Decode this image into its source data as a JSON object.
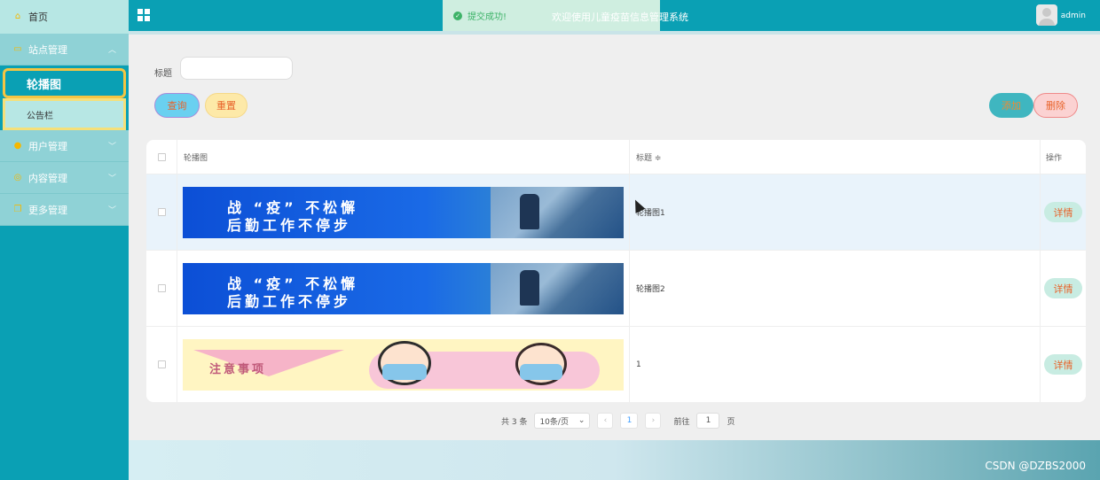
{
  "sidebar": {
    "home": {
      "label": "首页",
      "icon": "home-icon"
    },
    "groups": [
      {
        "label": "站点管理",
        "icon": "monitor-icon",
        "expanded": true
      },
      {
        "label": "用户管理",
        "icon": "user-icon",
        "expanded": false
      },
      {
        "label": "内容管理",
        "icon": "content-icon",
        "expanded": false
      },
      {
        "label": "更多管理",
        "icon": "more-icon",
        "expanded": false
      }
    ],
    "sub_items": [
      {
        "label": "轮播图",
        "active": true
      },
      {
        "label": "公告栏",
        "active": false
      }
    ]
  },
  "topbar": {
    "toast": "提交成功!",
    "welcome": "欢迎使用儿童疫苗信息管理系统",
    "user": "admin"
  },
  "search": {
    "label": "标题",
    "value": "",
    "placeholder": ""
  },
  "buttons": {
    "query": "查询",
    "reset": "重置",
    "add": "添加",
    "delete": "删除",
    "detail": "详情"
  },
  "table": {
    "columns": [
      "轮播图",
      "标题 ≑",
      "操作"
    ],
    "rows": [
      {
        "banner_line1": "战 “疫” 不松懈",
        "banner_line2": "后勤工作不停步",
        "title": "轮播图1",
        "highlighted": true
      },
      {
        "banner_line1": "战 “疫” 不松懈",
        "banner_line2": "后勤工作不停步",
        "title": "轮播图2",
        "highlighted": false
      },
      {
        "banner_line1": "注意事项",
        "banner_line2": "",
        "title": "1",
        "highlighted": false
      }
    ]
  },
  "pagination": {
    "total": "共 3 条",
    "page_size": "10条/页",
    "current_page": "1",
    "goto_label": "前往",
    "goto_value": "1",
    "page_unit": "页"
  },
  "watermark": "CSDN @DZBS2000",
  "colors": {
    "primary": "#0aa0b4",
    "sidebar_light": "#b7e7e4",
    "accent_orange": "#e8632a",
    "active_border": "#f5c542"
  }
}
